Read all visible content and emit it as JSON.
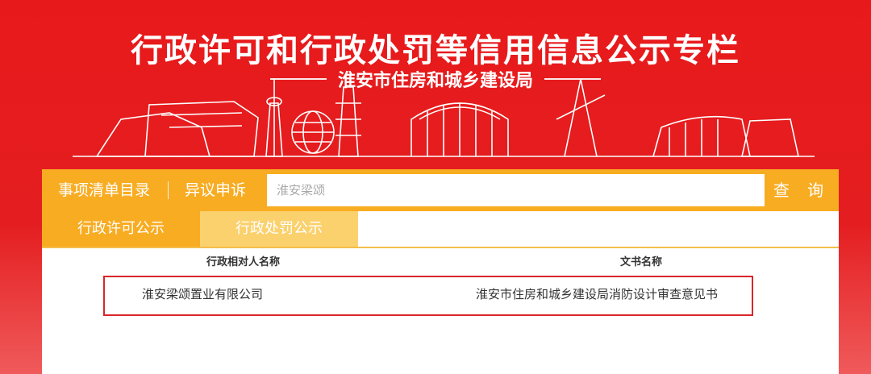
{
  "banner": {
    "title": "行政许可和行政处罚等信用信息公示专栏",
    "subtitle": "淮安市住房和城乡建设局"
  },
  "search_bar": {
    "nav_items": [
      "事项清单目录",
      "异议申诉"
    ],
    "input_value": "淮安梁颂",
    "query_label": "查 询"
  },
  "tabs": [
    "行政许可公示",
    "行政处罚公示"
  ],
  "table": {
    "headers": [
      "行政相对人名称",
      "文书名称"
    ],
    "rows": [
      {
        "party": "淮安梁颂置业有限公司",
        "document": "淮安市住房和城乡建设局消防设计审查意见书"
      }
    ]
  },
  "colors": {
    "banner_red": "#e8191b",
    "accent_orange": "#f8ac22",
    "tab_light": "#fbd16d",
    "highlight_border": "#d9262b"
  }
}
